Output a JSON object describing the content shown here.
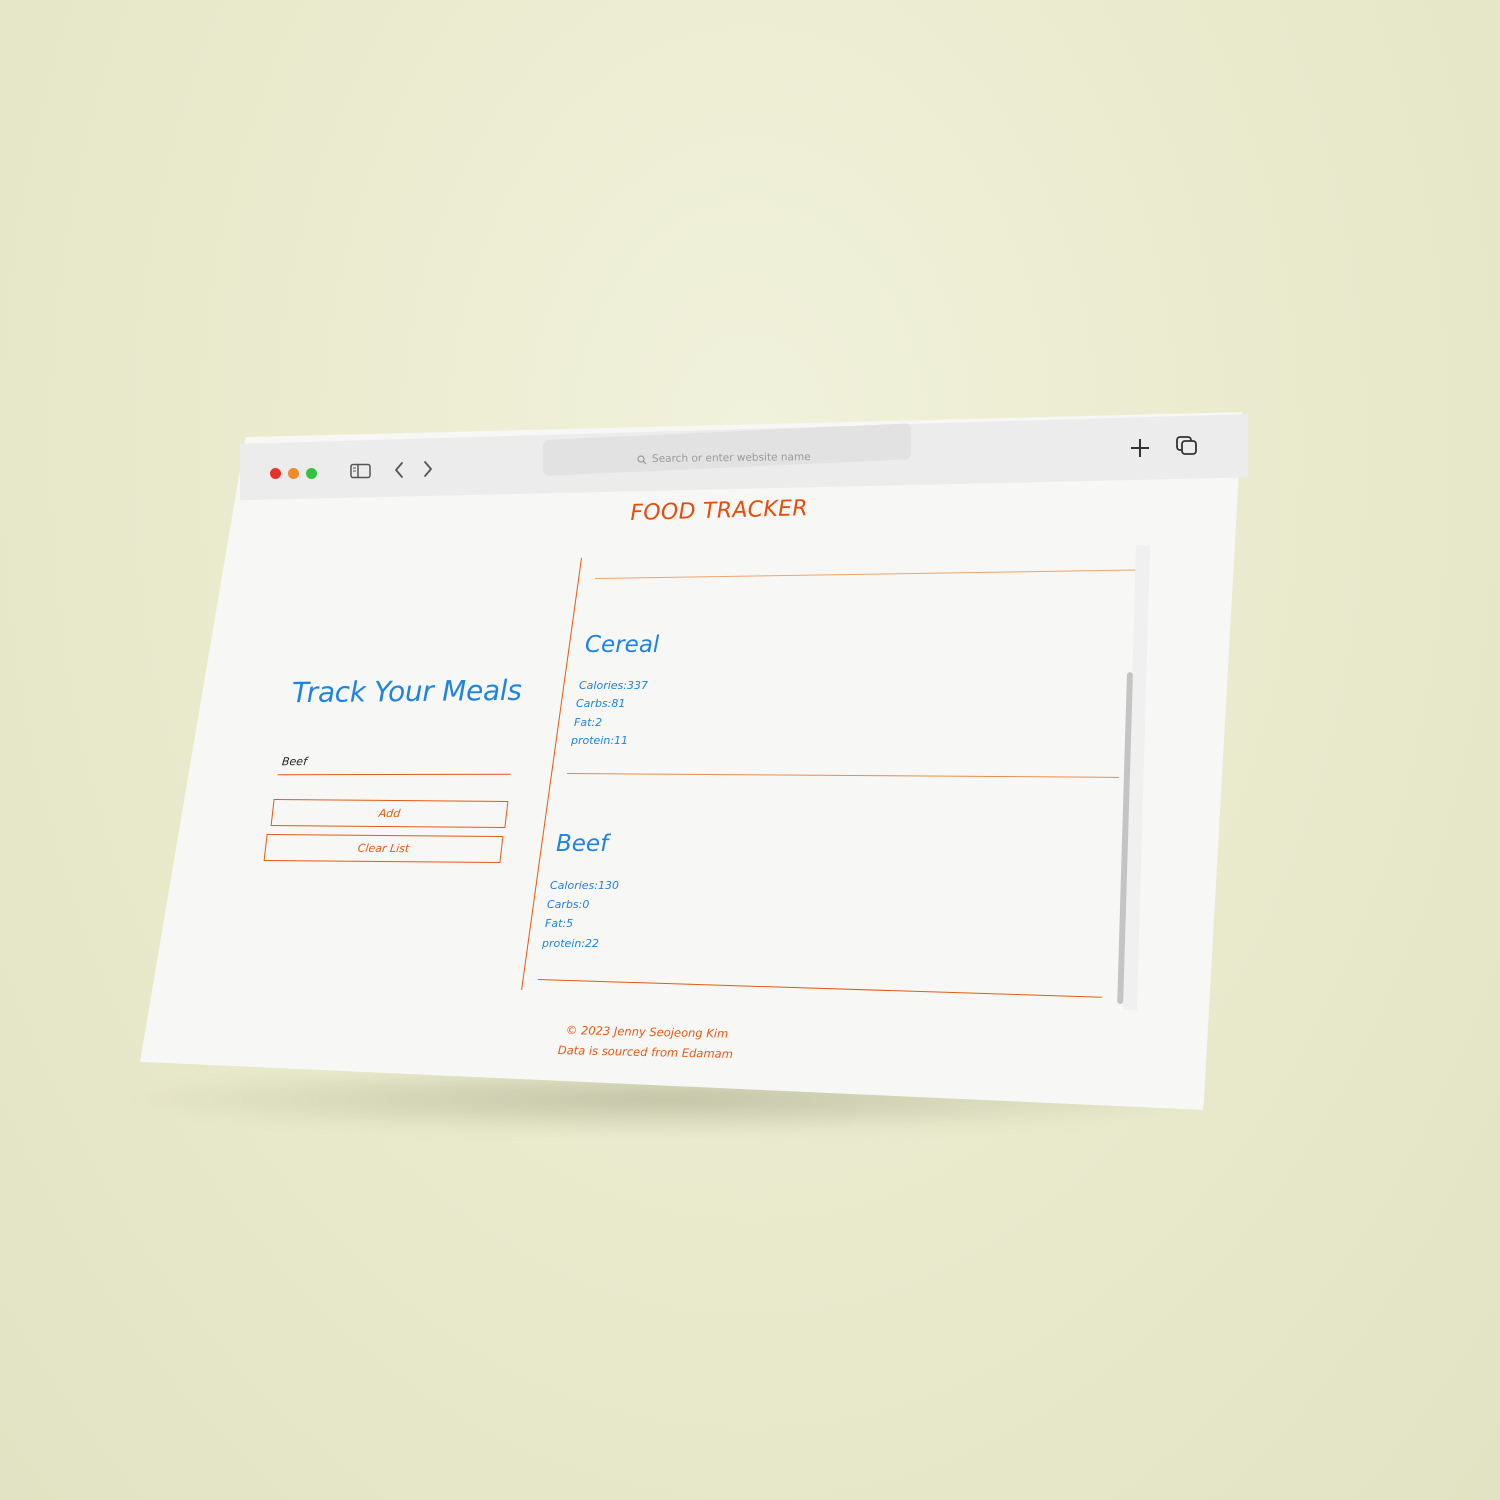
{
  "browser": {
    "address_placeholder": "Search or enter website name"
  },
  "page": {
    "title": "FOOD TRACKER",
    "heading": "Track Your  Meals",
    "input_value": "Beef",
    "add_label": "Add",
    "clear_label": "Clear  List"
  },
  "foods": [
    {
      "name": "Cereal",
      "calories": "Calories:337",
      "carbs": "Carbs:81",
      "fat": "Fat:2",
      "protein": "protein:11"
    },
    {
      "name": "Beef",
      "calories": "Calories:130",
      "carbs": "Carbs:0",
      "fat": "Fat:5",
      "protein": "protein:22"
    }
  ],
  "footer": {
    "copyright": "© 2023 Jenny Seojeong  Kim",
    "source": "Data is sourced from Edamam"
  },
  "colors": {
    "accent_orange": "#e65a12",
    "accent_blue": "#1f83e0",
    "background": "#e9e9cc",
    "page": "#f7f7f5"
  },
  "icons": [
    "sidebar-icon",
    "back-arrow-icon",
    "forward-arrow-icon",
    "search-icon",
    "new-tab-icon",
    "tabs-overview-icon"
  ]
}
